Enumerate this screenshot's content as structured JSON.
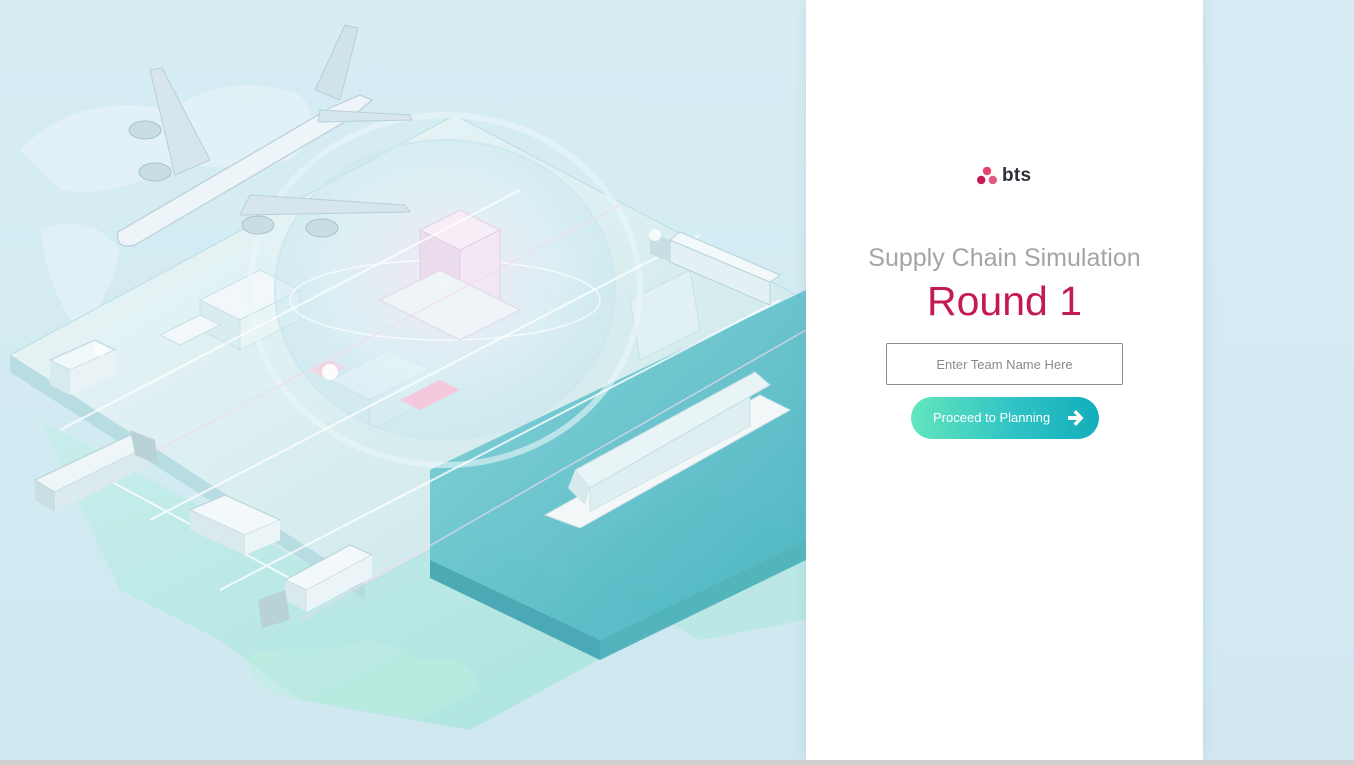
{
  "brand": {
    "name": "bts",
    "logo_icon": "three-dots-logo-icon",
    "logo_colors": [
      "#e8426f",
      "#c41a54",
      "#e05a86"
    ]
  },
  "main": {
    "subtitle": "Supply Chain Simulation",
    "round_label": "Round 1",
    "team_input": {
      "value": "",
      "placeholder": "Enter Team Name Here"
    },
    "proceed_button": {
      "label": "Proceed to Planning",
      "icon": "arrow-right-icon"
    }
  },
  "colors": {
    "accent": "#c41a54",
    "button_gradient_start": "#63e6bd",
    "button_gradient_end": "#13aebb",
    "hero_background": "#d6ecf3"
  }
}
